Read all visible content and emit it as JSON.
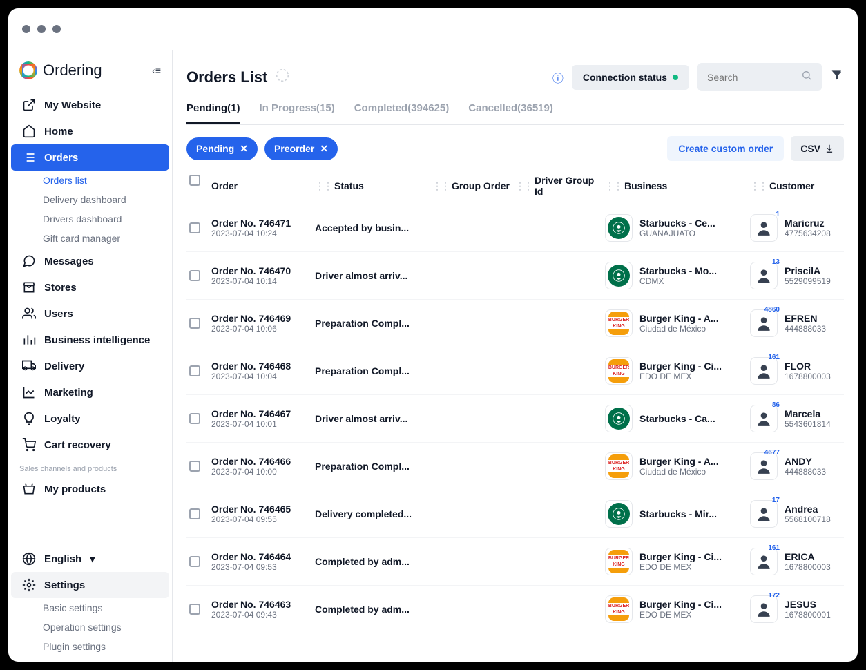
{
  "brand": "Ordering",
  "sidebar": {
    "items": [
      {
        "label": "My Website",
        "icon": "external-link"
      },
      {
        "label": "Home",
        "icon": "home"
      },
      {
        "label": "Orders",
        "icon": "list",
        "active": true,
        "subs": [
          {
            "label": "Orders list",
            "active": true
          },
          {
            "label": "Delivery dashboard"
          },
          {
            "label": "Drivers dashboard"
          },
          {
            "label": "Gift card manager"
          }
        ]
      },
      {
        "label": "Messages",
        "icon": "chat"
      },
      {
        "label": "Stores",
        "icon": "store"
      },
      {
        "label": "Users",
        "icon": "users"
      },
      {
        "label": "Business intelligence",
        "icon": "bars"
      },
      {
        "label": "Delivery",
        "icon": "truck"
      },
      {
        "label": "Marketing",
        "icon": "trend"
      },
      {
        "label": "Loyalty",
        "icon": "bulb"
      },
      {
        "label": "Cart recovery",
        "icon": "cart"
      }
    ],
    "section_label": "Sales channels and products",
    "products_item": "My products",
    "language": "English",
    "settings": "Settings",
    "settings_subs": [
      "Basic settings",
      "Operation settings",
      "Plugin settings"
    ]
  },
  "header": {
    "title": "Orders List",
    "connection": "Connection status",
    "search_placeholder": "Search"
  },
  "tabs": [
    {
      "label": "Pending(1)",
      "active": true
    },
    {
      "label": "In Progress(15)"
    },
    {
      "label": "Completed(394625)"
    },
    {
      "label": "Cancelled(36519)"
    }
  ],
  "chips": [
    "Pending",
    "Preorder"
  ],
  "actions": {
    "create": "Create custom order",
    "csv": "CSV"
  },
  "columns": [
    "Order",
    "Status",
    "Group Order",
    "Driver Group Id",
    "Business",
    "Customer"
  ],
  "orders": [
    {
      "no": "Order No. 746471",
      "date": "2023-07-04 10:24",
      "status": "Accepted by busin...",
      "biz": "Starbucks - Ce...",
      "loc": "GUANAJUATO",
      "cust": "Maricruz",
      "phone": "4775634208",
      "badge": "1",
      "brand": "starbucks"
    },
    {
      "no": "Order No. 746470",
      "date": "2023-07-04 10:14",
      "status": "Driver almost arriv...",
      "biz": "Starbucks - Mo...",
      "loc": "CDMX",
      "cust": "PriscilA",
      "phone": "5529099519",
      "badge": "13",
      "brand": "starbucks"
    },
    {
      "no": "Order No. 746469",
      "date": "2023-07-04 10:06",
      "status": "Preparation Compl...",
      "biz": "Burger King - A...",
      "loc": "Ciudad de México",
      "cust": "EFREN",
      "phone": "444888033",
      "badge": "4860",
      "brand": "bk"
    },
    {
      "no": "Order No. 746468",
      "date": "2023-07-04 10:04",
      "status": "Preparation Compl...",
      "biz": "Burger King - Ci...",
      "loc": "EDO DE MEX",
      "cust": "FLOR",
      "phone": "1678800003",
      "badge": "161",
      "brand": "bk"
    },
    {
      "no": "Order No. 746467",
      "date": "2023-07-04 10:01",
      "status": "Driver almost arriv...",
      "biz": "Starbucks - Ca...",
      "loc": "",
      "cust": "Marcela",
      "phone": "5543601814",
      "badge": "86",
      "brand": "starbucks"
    },
    {
      "no": "Order No. 746466",
      "date": "2023-07-04 10:00",
      "status": "Preparation Compl...",
      "biz": "Burger King - A...",
      "loc": "Ciudad de México",
      "cust": "ANDY",
      "phone": "444888033",
      "badge": "4677",
      "brand": "bk"
    },
    {
      "no": "Order No. 746465",
      "date": "2023-07-04 09:55",
      "status": "Delivery completed...",
      "biz": "Starbucks - Mir...",
      "loc": "",
      "cust": "Andrea",
      "phone": "5568100718",
      "badge": "17",
      "brand": "starbucks"
    },
    {
      "no": "Order No. 746464",
      "date": "2023-07-04 09:53",
      "status": "Completed by adm...",
      "biz": "Burger King - Ci...",
      "loc": "EDO DE MEX",
      "cust": "ERICA",
      "phone": "1678800003",
      "badge": "161",
      "brand": "bk"
    },
    {
      "no": "Order No. 746463",
      "date": "2023-07-04 09:43",
      "status": "Completed by adm...",
      "biz": "Burger King - Ci...",
      "loc": "EDO DE MEX",
      "cust": "JESUS",
      "phone": "1678800001",
      "badge": "172",
      "brand": "bk"
    }
  ]
}
